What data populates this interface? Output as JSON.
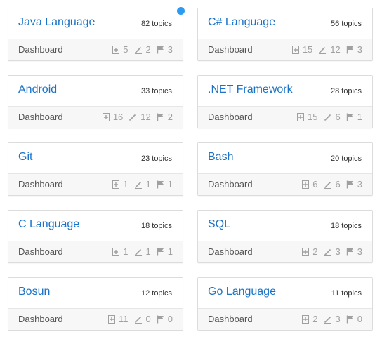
{
  "accent_color": "#1a73c8",
  "notification_dot_color": "#2b9af3",
  "cards": [
    {
      "title": "Java Language",
      "topics": "82 topics",
      "footer": "Dashboard",
      "icons": [
        "new-post-icon",
        "edit-icon",
        "flag-icon"
      ],
      "stats": [
        "5",
        "2",
        "3"
      ],
      "has_notification": true
    },
    {
      "title": "C# Language",
      "topics": "56 topics",
      "footer": "Dashboard",
      "icons": [
        "new-post-icon",
        "edit-icon",
        "flag-icon"
      ],
      "stats": [
        "15",
        "12",
        "3"
      ],
      "has_notification": false
    },
    {
      "title": "Android",
      "topics": "33 topics",
      "footer": "Dashboard",
      "icons": [
        "new-post-icon",
        "edit-icon",
        "flag-icon"
      ],
      "stats": [
        "16",
        "12",
        "2"
      ],
      "has_notification": false
    },
    {
      "title": ".NET Framework",
      "topics": "28 topics",
      "footer": "Dashboard",
      "icons": [
        "new-post-icon",
        "edit-icon",
        "flag-icon"
      ],
      "stats": [
        "15",
        "6",
        "1"
      ],
      "has_notification": false
    },
    {
      "title": "Git",
      "topics": "23 topics",
      "footer": "Dashboard",
      "icons": [
        "new-post-icon",
        "edit-icon",
        "flag-icon"
      ],
      "stats": [
        "1",
        "1",
        "1"
      ],
      "has_notification": false
    },
    {
      "title": "Bash",
      "topics": "20 topics",
      "footer": "Dashboard",
      "icons": [
        "new-post-icon",
        "edit-icon",
        "flag-icon"
      ],
      "stats": [
        "6",
        "6",
        "3"
      ],
      "has_notification": false
    },
    {
      "title": "C Language",
      "topics": "18 topics",
      "footer": "Dashboard",
      "icons": [
        "new-post-icon",
        "edit-icon",
        "flag-icon"
      ],
      "stats": [
        "1",
        "1",
        "1"
      ],
      "has_notification": false
    },
    {
      "title": "SQL",
      "topics": "18 topics",
      "footer": "Dashboard",
      "icons": [
        "new-post-icon",
        "edit-icon",
        "flag-icon"
      ],
      "stats": [
        "2",
        "3",
        "3"
      ],
      "has_notification": false
    },
    {
      "title": "Bosun",
      "topics": "12 topics",
      "footer": "Dashboard",
      "icons": [
        "new-post-icon",
        "edit-icon",
        "flag-icon"
      ],
      "stats": [
        "11",
        "0",
        "0"
      ],
      "has_notification": false
    },
    {
      "title": "Go Language",
      "topics": "11 topics",
      "footer": "Dashboard",
      "icons": [
        "new-post-icon",
        "edit-icon",
        "flag-icon"
      ],
      "stats": [
        "2",
        "3",
        "0"
      ],
      "has_notification": false
    }
  ]
}
